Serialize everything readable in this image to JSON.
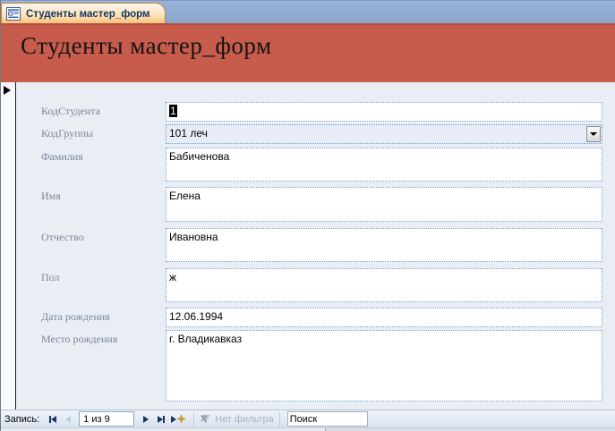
{
  "window": {
    "tab_title": "Студенты мастер_форм",
    "header_title": "Студенты мастер_форм"
  },
  "form": {
    "fields": [
      {
        "label": "КодСтудента",
        "value": "1"
      },
      {
        "label": "КодГруппы",
        "value": "101 леч"
      },
      {
        "label": "Фамилия",
        "value": "Бабиченова"
      },
      {
        "label": "Имя",
        "value": "Елена"
      },
      {
        "label": "Отчество",
        "value": "Ивановна"
      },
      {
        "label": "Пол",
        "value": "ж"
      },
      {
        "label": "Дата рождения",
        "value": "12.06.1994"
      },
      {
        "label": "Место рождения",
        "value": "г. Владикавказ"
      }
    ]
  },
  "navbar": {
    "record_label": "Запись:",
    "position": "1 из 9",
    "filter_label": "Нет фильтра",
    "search_value": "Поиск",
    "icons": {
      "first": "first-record-icon",
      "previous": "previous-record-icon",
      "next": "next-record-icon",
      "last": "last-record-icon",
      "new": "new-record-with-star-icon",
      "filter": "filter-crossed-icon"
    }
  },
  "colors": {
    "header_background": "#C75B4C",
    "tab_strip_background": "#8FA9D1",
    "tab_background": "#F8BF74",
    "form_background": "#E9EEF5",
    "field_border": "#6F9BD1",
    "selection_background": "#000000",
    "label_color": "#7C8799",
    "new_record_star": "#E3A21A"
  }
}
